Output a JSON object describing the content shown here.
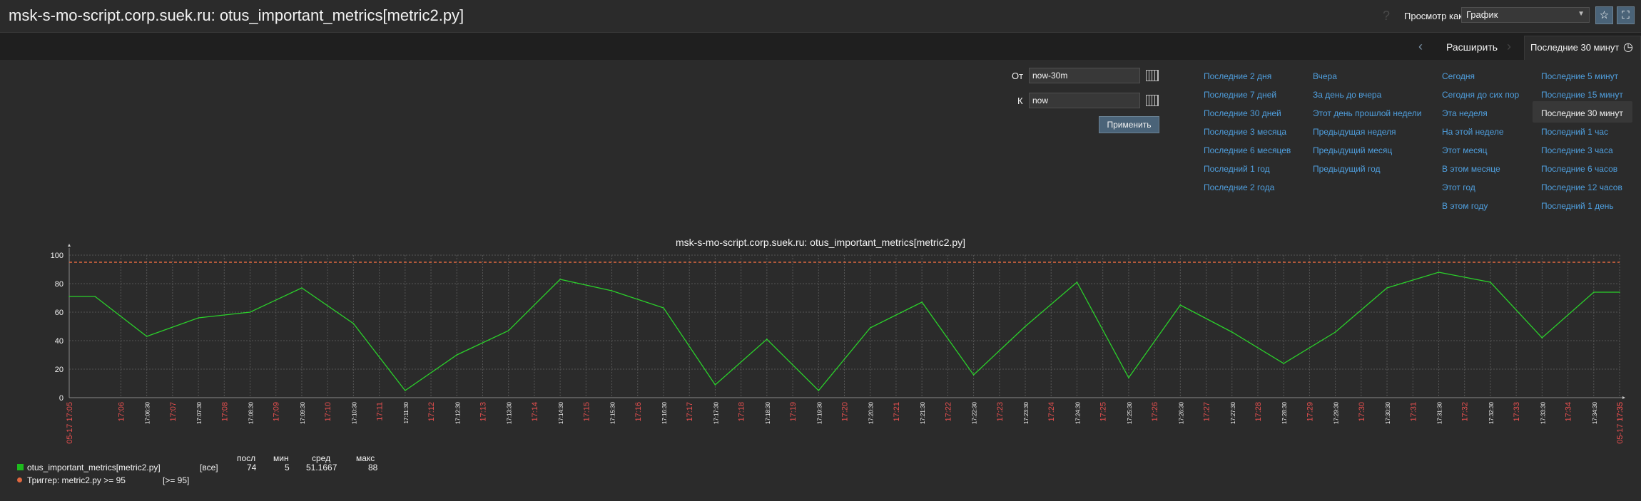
{
  "header": {
    "title": "msk-s-mo-script.corp.suek.ru: otus_important_metrics[metric2.py]",
    "help_glyph": "?",
    "view_as_label": "Просмотр как",
    "view_as_value": "График",
    "favorite_glyph": "☆",
    "fullscreen_glyph": "⛶"
  },
  "timebar": {
    "expand_label": "Расширить",
    "range_label": "Последние 30 минут"
  },
  "filter": {
    "from_label": "От",
    "from_value": "now-30m",
    "to_label": "К",
    "to_value": "now",
    "apply_label": "Применить",
    "quick_columns": [
      [
        "Последние 2 дня",
        "Последние 7 дней",
        "Последние 30 дней",
        "Последние 3 месяца",
        "Последние 6 месяцев",
        "Последний 1 год",
        "Последние 2 года"
      ],
      [
        "Вчера",
        "За день до вчера",
        "Этот день прошлой недели",
        "Предыдущая неделя",
        "Предыдущий месяц",
        "Предыдущий год"
      ],
      [
        "Сегодня",
        "Сегодня до сих пор",
        "Эта неделя",
        "На этой неделе",
        "Этот месяц",
        "В этом месяце",
        "Этот год",
        "В этом году"
      ],
      [
        "Последние 5 минут",
        "Последние 15 минут",
        "Последние 30 минут",
        "Последний 1 час",
        "Последние 3 часа",
        "Последние 6 часов",
        "Последние 12 часов",
        "Последний 1 день"
      ]
    ],
    "active_quick": "Последние 30 минут"
  },
  "graph": {
    "title": "msk-s-mo-script.corp.suek.ru: otus_important_metrics[metric2.py]",
    "legend": {
      "item_name": "otus_important_metrics[metric2.py]",
      "item_scope": "[все]",
      "col_last": "посл",
      "col_min": "мин",
      "col_avg": "сред",
      "col_max": "макс",
      "last": "74",
      "min": "5",
      "avg": "51.1667",
      "max": "88",
      "trigger_label": "Триггер: metric2.py >= 95",
      "trigger_cond": "[>= 95]"
    },
    "colors": {
      "line": "#2bd02b",
      "trigger": "#e0673f",
      "grid": "#555555",
      "tick_red": "#e84f4f",
      "tick_white": "#f2f2f2"
    }
  },
  "chart_data": {
    "type": "line",
    "title": "msk-s-mo-script.corp.suek.ru: otus_important_metrics[metric2.py]",
    "ylim": [
      0,
      100
    ],
    "y_ticks": [
      "0",
      "20",
      "40",
      "60",
      "80",
      "100"
    ],
    "x_start_label": "05-17 17:05",
    "x_end_label": "05-17 17:35",
    "x_ticks": [
      "17:06",
      "17:06:30",
      "17:07",
      "17:07:30",
      "17:08",
      "17:08:30",
      "17:09",
      "17:09:30",
      "17:10",
      "17:10:30",
      "17:11",
      "17:11:30",
      "17:12",
      "17:12:30",
      "17:13",
      "17:13:30",
      "17:14",
      "17:14:30",
      "17:15",
      "17:15:30",
      "17:16",
      "17:16:30",
      "17:17",
      "17:17:30",
      "17:18",
      "17:18:30",
      "17:19",
      "17:19:30",
      "17:20",
      "17:20:30",
      "17:21",
      "17:21:30",
      "17:22",
      "17:22:30",
      "17:23",
      "17:23:30",
      "17:24",
      "17:24:30",
      "17:25",
      "17:25:30",
      "17:26",
      "17:26:30",
      "17:27",
      "17:27:30",
      "17:28",
      "17:28:30",
      "17:29",
      "17:29:30",
      "17:30",
      "17:30:30",
      "17:31",
      "17:31:30",
      "17:32",
      "17:32:30",
      "17:33",
      "17:33:30",
      "17:34",
      "17:34:30",
      "17:35"
    ],
    "trigger_threshold": 95,
    "series": [
      {
        "name": "otus_important_metrics[metric2.py]",
        "points": [
          [
            "17:05:00",
            71
          ],
          [
            "17:05:30",
            71
          ],
          [
            "17:06:30",
            43
          ],
          [
            "17:07:30",
            56
          ],
          [
            "17:08:30",
            60
          ],
          [
            "17:09:30",
            77
          ],
          [
            "17:10:30",
            52
          ],
          [
            "17:11:30",
            5
          ],
          [
            "17:12:30",
            30
          ],
          [
            "17:13:30",
            47
          ],
          [
            "17:14:30",
            83
          ],
          [
            "17:15:30",
            75
          ],
          [
            "17:16:30",
            63
          ],
          [
            "17:17:30",
            9
          ],
          [
            "17:18:30",
            41
          ],
          [
            "17:19:30",
            5
          ],
          [
            "17:20:30",
            49
          ],
          [
            "17:21:30",
            67
          ],
          [
            "17:22:30",
            16
          ],
          [
            "17:23:30",
            50
          ],
          [
            "17:24:30",
            81
          ],
          [
            "17:25:30",
            14
          ],
          [
            "17:26:30",
            65
          ],
          [
            "17:27:30",
            46
          ],
          [
            "17:28:30",
            24
          ],
          [
            "17:29:30",
            46
          ],
          [
            "17:30:30",
            77
          ],
          [
            "17:31:30",
            88
          ],
          [
            "17:32:30",
            81
          ],
          [
            "17:33:30",
            42
          ],
          [
            "17:34:30",
            74
          ],
          [
            "17:35:00",
            74
          ]
        ]
      }
    ]
  }
}
